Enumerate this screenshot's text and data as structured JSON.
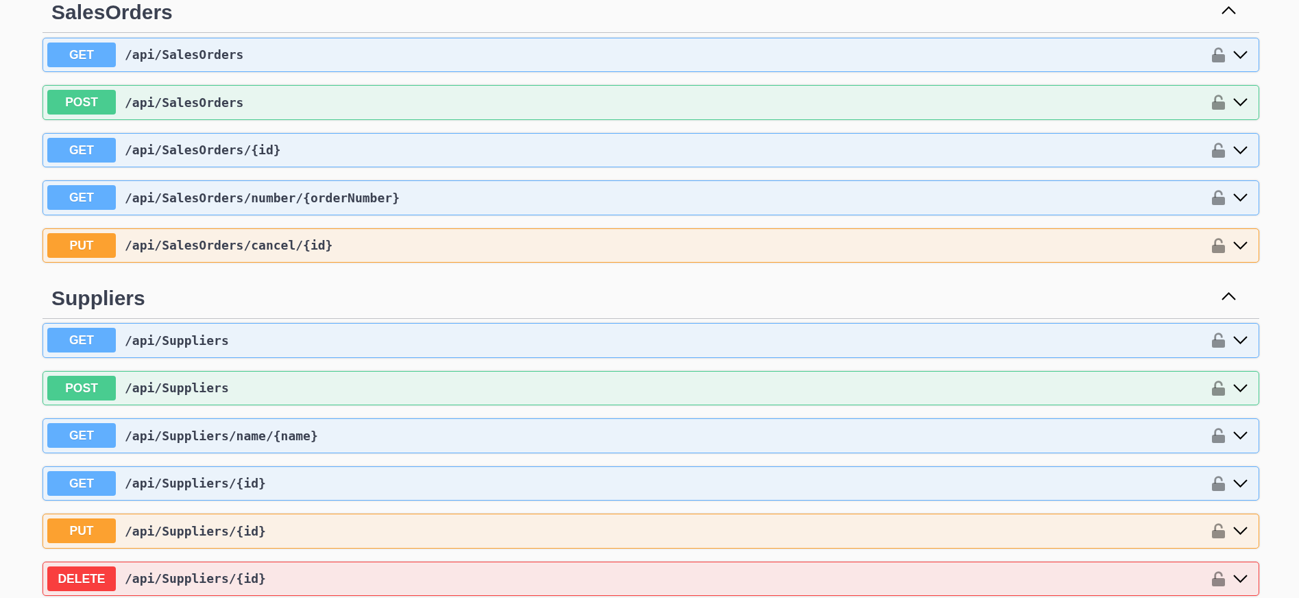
{
  "sections": [
    {
      "title": "SalesOrders",
      "expanded": true,
      "operations": [
        {
          "kind": "get",
          "method": "GET",
          "path": "/api/SalesOrders",
          "locked": false,
          "expanded": false
        },
        {
          "kind": "post",
          "method": "POST",
          "path": "/api/SalesOrders",
          "locked": false,
          "expanded": false
        },
        {
          "kind": "get",
          "method": "GET",
          "path": "/api/SalesOrders/{id}",
          "locked": false,
          "expanded": false
        },
        {
          "kind": "get",
          "method": "GET",
          "path": "/api/SalesOrders/number/{orderNumber}",
          "locked": false,
          "expanded": false
        },
        {
          "kind": "put",
          "method": "PUT",
          "path": "/api/SalesOrders/cancel/{id}",
          "locked": false,
          "expanded": false
        }
      ]
    },
    {
      "title": "Suppliers",
      "expanded": true,
      "operations": [
        {
          "kind": "get",
          "method": "GET",
          "path": "/api/Suppliers",
          "locked": false,
          "expanded": false
        },
        {
          "kind": "post",
          "method": "POST",
          "path": "/api/Suppliers",
          "locked": false,
          "expanded": false
        },
        {
          "kind": "get",
          "method": "GET",
          "path": "/api/Suppliers/name/{name}",
          "locked": false,
          "expanded": false
        },
        {
          "kind": "get",
          "method": "GET",
          "path": "/api/Suppliers/{id}",
          "locked": false,
          "expanded": false
        },
        {
          "kind": "put",
          "method": "PUT",
          "path": "/api/Suppliers/{id}",
          "locked": false,
          "expanded": false
        },
        {
          "kind": "delete",
          "method": "DELETE",
          "path": "/api/Suppliers/{id}",
          "locked": false,
          "expanded": false
        }
      ]
    }
  ]
}
